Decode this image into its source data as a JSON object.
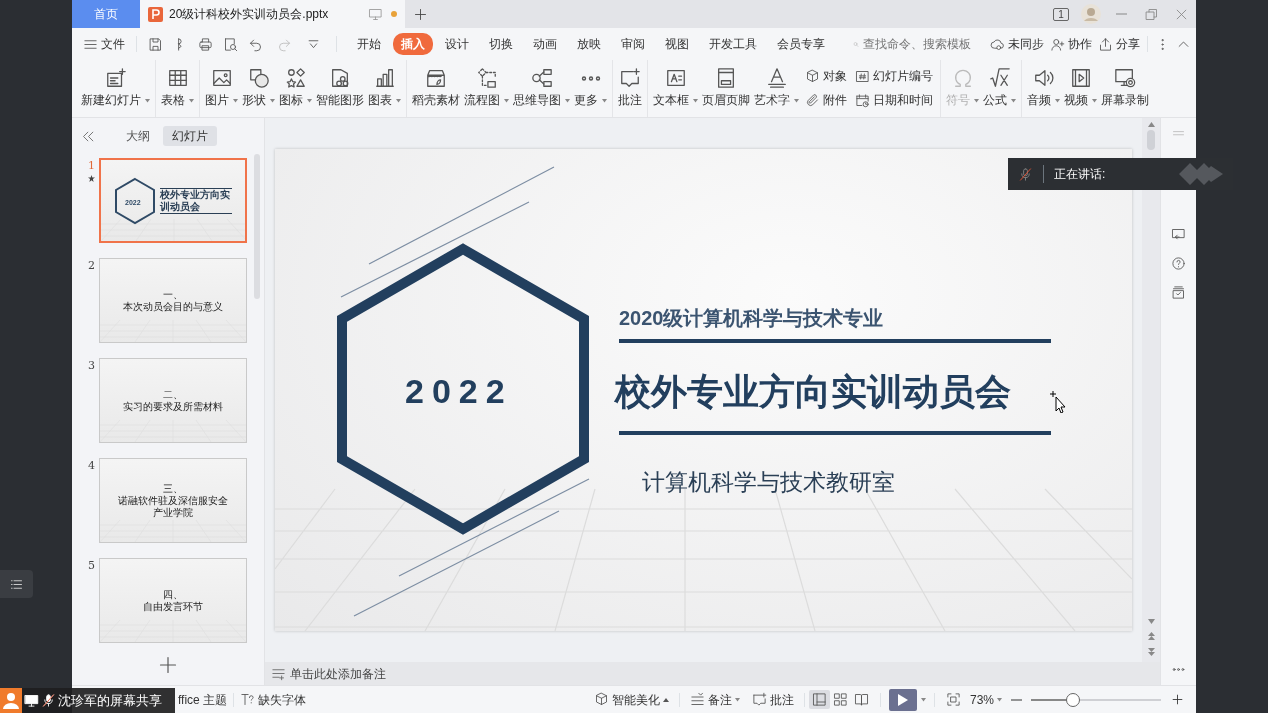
{
  "title_bar": {
    "home_tab": "首页",
    "document_tab": {
      "title": "20级计科校外实训动员会.pptx",
      "modified": true
    },
    "window_count": "1"
  },
  "menu_bar": {
    "file": "文件",
    "tabs": [
      {
        "label": "开始",
        "selected": false
      },
      {
        "label": "插入",
        "selected": true
      },
      {
        "label": "设计",
        "selected": false
      },
      {
        "label": "切换",
        "selected": false
      },
      {
        "label": "动画",
        "selected": false
      },
      {
        "label": "放映",
        "selected": false
      },
      {
        "label": "审阅",
        "selected": false
      },
      {
        "label": "视图",
        "selected": false
      },
      {
        "label": "开发工具",
        "selected": false
      },
      {
        "label": "会员专享",
        "selected": false
      }
    ],
    "search": {
      "placeholder": "查找命令、搜索模板"
    },
    "actions": [
      "未同步",
      "协作",
      "分享"
    ]
  },
  "ribbon": {
    "groups": [
      {
        "items": [
          {
            "kind": "large",
            "label": "新建幻灯片",
            "dropdown": true,
            "disabled": false
          }
        ]
      },
      {
        "items": [
          {
            "kind": "large",
            "label": "表格",
            "dropdown": true,
            "disabled": false
          }
        ]
      },
      {
        "items": [
          {
            "kind": "large",
            "label": "图片",
            "dropdown": true,
            "disabled": false
          },
          {
            "kind": "large",
            "label": "形状",
            "dropdown": true,
            "disabled": false
          },
          {
            "kind": "large",
            "label": "图标",
            "dropdown": true,
            "disabled": false
          },
          {
            "kind": "large",
            "label": "智能图形",
            "dropdown": false,
            "disabled": false
          },
          {
            "kind": "large",
            "label": "图表",
            "dropdown": true,
            "disabled": false
          }
        ]
      },
      {
        "items": [
          {
            "kind": "large",
            "label": "稻壳素材",
            "dropdown": false,
            "disabled": false
          },
          {
            "kind": "large",
            "label": "流程图",
            "dropdown": true,
            "disabled": false
          },
          {
            "kind": "large",
            "label": "思维导图",
            "dropdown": true,
            "disabled": false
          },
          {
            "kind": "large",
            "label": "更多",
            "dropdown": true,
            "disabled": false
          }
        ]
      },
      {
        "items": [
          {
            "kind": "large",
            "label": "批注",
            "dropdown": false,
            "disabled": false
          }
        ]
      },
      {
        "items": [
          {
            "kind": "large",
            "label": "文本框",
            "dropdown": true,
            "disabled": false
          },
          {
            "kind": "large",
            "label": "页眉页脚",
            "dropdown": false,
            "disabled": false
          },
          {
            "kind": "large",
            "label": "艺术字",
            "dropdown": true,
            "disabled": false
          },
          {
            "kind": "stack",
            "items": [
              "对象",
              "附件"
            ]
          },
          {
            "kind": "stack",
            "items": [
              "幻灯片编号",
              "日期和时间"
            ]
          }
        ]
      },
      {
        "items": [
          {
            "kind": "large",
            "label": "符号",
            "dropdown": true,
            "disabled": true
          },
          {
            "kind": "large",
            "label": "公式",
            "dropdown": true,
            "disabled": false
          }
        ]
      },
      {
        "items": [
          {
            "kind": "large",
            "label": "音频",
            "dropdown": true,
            "disabled": false
          },
          {
            "kind": "large",
            "label": "视频",
            "dropdown": true,
            "disabled": false
          },
          {
            "kind": "large",
            "label": "屏幕录制",
            "dropdown": false,
            "disabled": false
          }
        ]
      }
    ]
  },
  "slides_panel": {
    "tabs": [
      {
        "label": "大纲",
        "selected": false
      },
      {
        "label": "幻灯片",
        "selected": true
      }
    ],
    "thumbnails": [
      {
        "number": "1",
        "selected": true,
        "animated": true,
        "kind": "cover",
        "year": "2022",
        "title": "校外专业方向实训动员会"
      },
      {
        "number": "2",
        "selected": false,
        "animated": false,
        "kind": "section",
        "heading": "一、",
        "title": "本次动员会目的与意义"
      },
      {
        "number": "3",
        "selected": false,
        "animated": false,
        "kind": "section",
        "heading": "二、",
        "title": "实习的要求及所需材料"
      },
      {
        "number": "4",
        "selected": false,
        "animated": false,
        "kind": "section",
        "heading": "三、",
        "title": "诺融软件驻及深信服安全产业学院"
      },
      {
        "number": "5",
        "selected": false,
        "animated": false,
        "kind": "section",
        "heading": "四、",
        "title": "自由发言环节"
      }
    ]
  },
  "slide": {
    "year": "2022",
    "subtitle": "2020级计算机科学与技术专业",
    "title": "校外专业方向实训动员会",
    "department": "计算机科学与技术教研室"
  },
  "notes_prompt": "单击此处添加备注",
  "status_bar": {
    "theme": "ffice 主题",
    "missing_fonts": "缺失字体",
    "smart_beautify": "智能美化",
    "notes": "备注",
    "comments": "批注",
    "views": [
      {
        "selected": true
      },
      {
        "selected": false
      },
      {
        "selected": false
      }
    ],
    "zoom": "73%",
    "zoom_slider": {
      "level": 0.32
    }
  },
  "overlays": {
    "screen_share": "沈珍军的屏幕共享",
    "speaking": "正在讲话:"
  }
}
